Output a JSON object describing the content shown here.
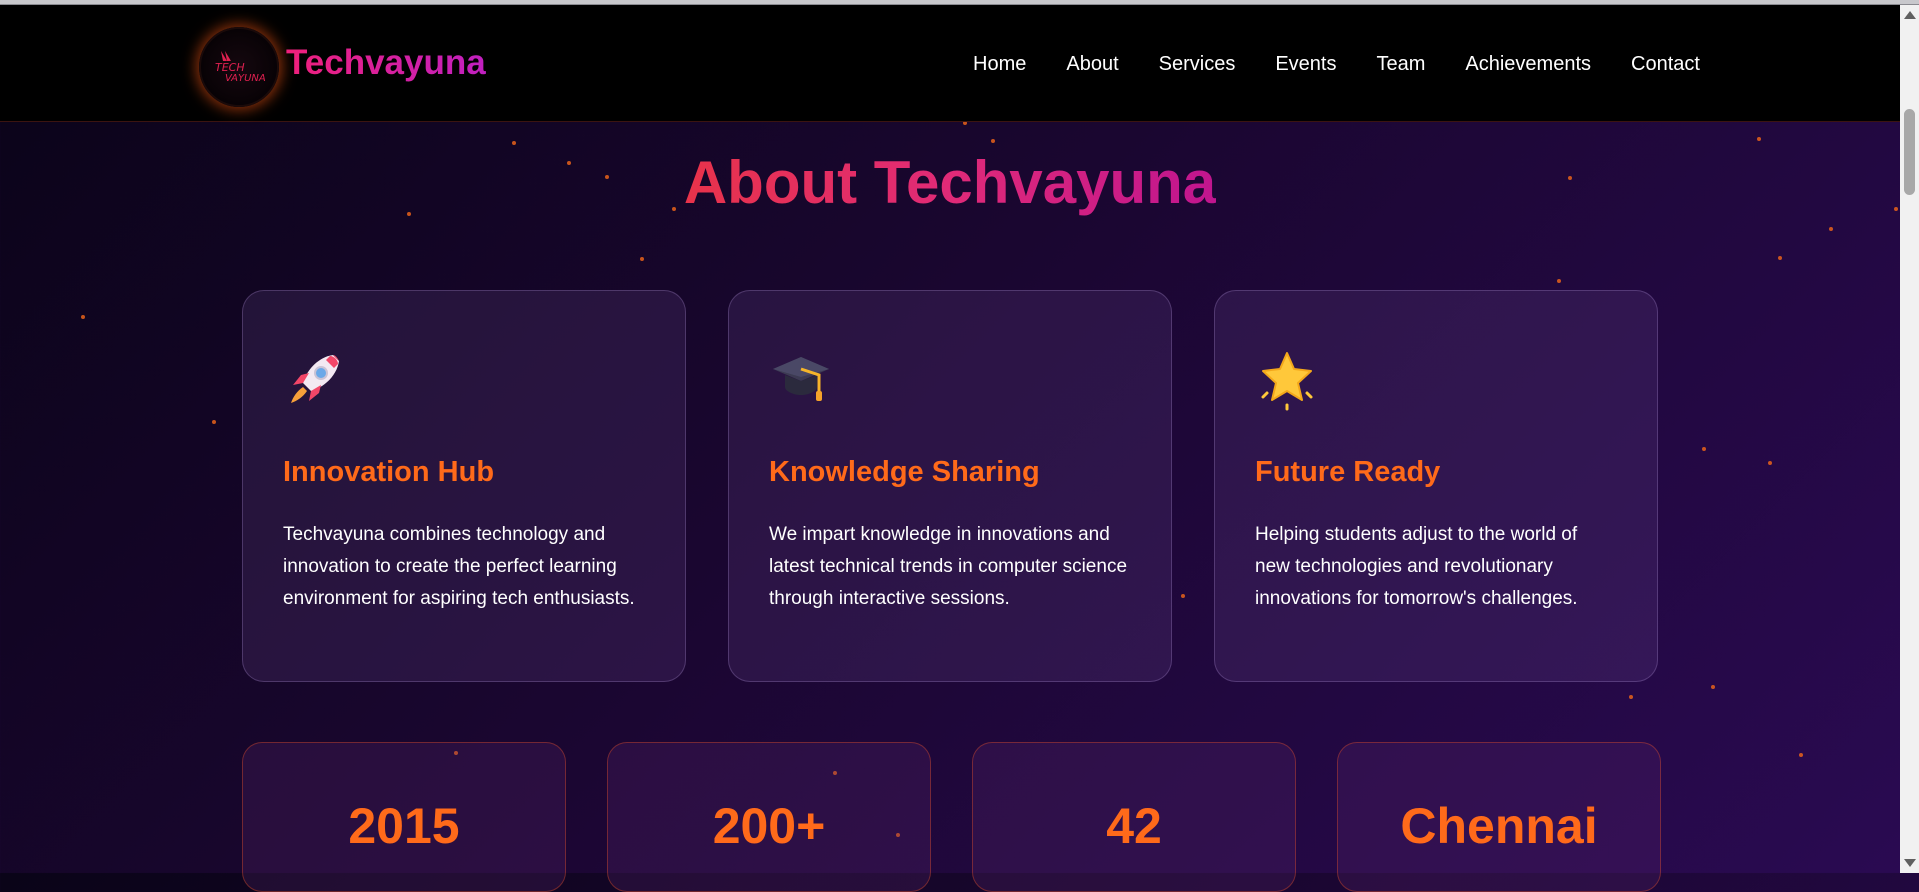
{
  "brand": {
    "name": "Techvayuna"
  },
  "nav": {
    "items": [
      "Home",
      "About",
      "Services",
      "Events",
      "Team",
      "Achievements",
      "Contact"
    ]
  },
  "about": {
    "title": "About Techvayuna",
    "cards": [
      {
        "icon": "rocket-icon",
        "title": "Innovation Hub",
        "text": "Techvayuna combines technology and innovation to create the perfect learning environment for aspiring tech enthusiasts."
      },
      {
        "icon": "graduation-cap-icon",
        "title": "Knowledge Sharing",
        "text": "We impart knowledge in innovations and latest technical trends in computer science through interactive sessions."
      },
      {
        "icon": "star-icon",
        "title": "Future Ready",
        "text": "Helping students adjust to the world of new technologies and revolutionary innovations for tomorrow's challenges."
      }
    ],
    "stats": [
      "2015",
      "200+",
      "42",
      "Chennai"
    ]
  },
  "colors": {
    "accent_orange": "#ff6a1a",
    "title_gradient_start": "#e8334a",
    "title_gradient_end": "#c0158f",
    "navbar_bg": "#000000"
  }
}
